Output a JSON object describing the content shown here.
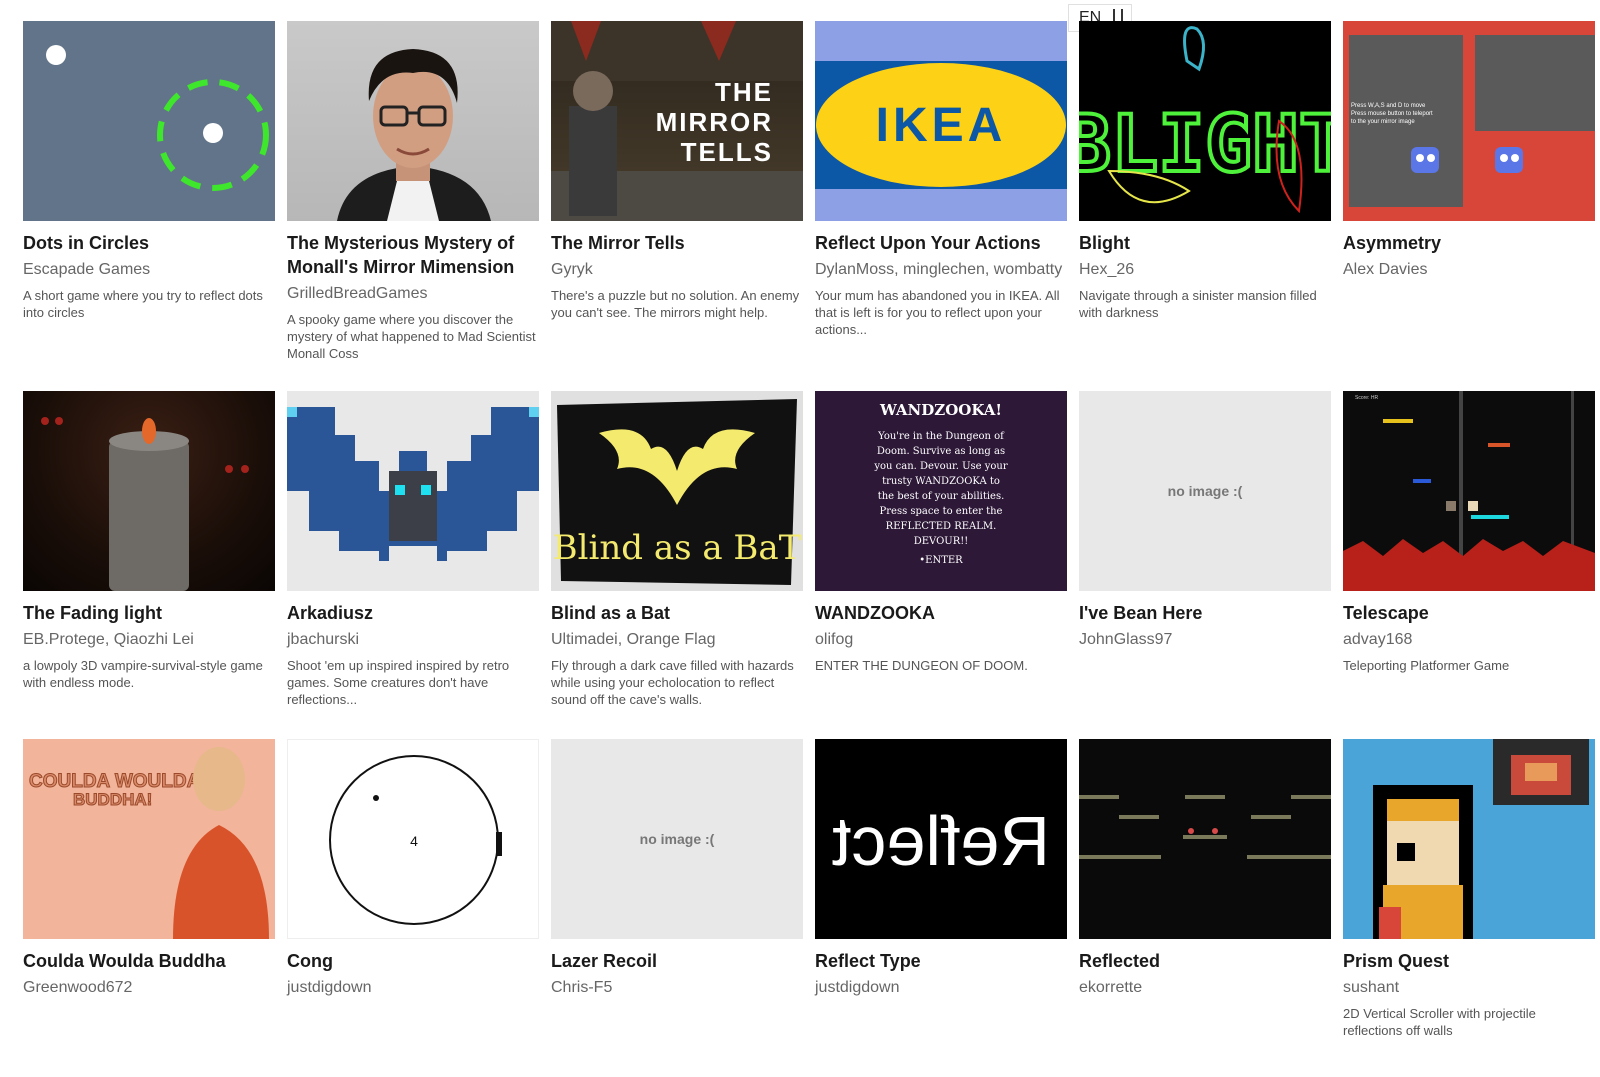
{
  "language_selector": {
    "label": "EN"
  },
  "games": [
    {
      "title": "Dots in Circles",
      "authors": [
        "Escapade Games"
      ],
      "description": "A short game where you try to reflect dots into circles",
      "image": "thumb-dots"
    },
    {
      "title": "The Mysterious Mystery of Monall's Mirror Mimension",
      "authors": [
        "GrilledBreadGames"
      ],
      "description": "A spooky game where you discover the mystery of what happened to Mad Scientist Monall Coss",
      "image": "thumb-portrait"
    },
    {
      "title": "The Mirror Tells",
      "authors": [
        "Gyryk"
      ],
      "description": "There's a puzzle but no solution. An enemy you can't see. The mirrors might help.",
      "image": "thumb-mirror-tells",
      "thumb_text": "THE\nMIRROR\nTELLS"
    },
    {
      "title": "Reflect Upon Your Actions",
      "authors": [
        "DylanMoss",
        "minglechen",
        "wombatty"
      ],
      "description": "Your mum has abandoned you in IKEA. All that is left is for you to reflect upon your actions...",
      "image": "thumb-ikea",
      "thumb_text": "IKEA"
    },
    {
      "title": "Blight",
      "authors": [
        "Hex_26"
      ],
      "description": "Navigate through a sinister mansion filled with darkness",
      "image": "thumb-blight",
      "thumb_text": "BLIGHT"
    },
    {
      "title": "Asymmetry",
      "authors": [
        "Alex Davies"
      ],
      "description": "",
      "image": "thumb-asymmetry",
      "thumb_text": "Press W,A,S and D to move\nPress mouse button to teleport\nto the your mirror image"
    },
    {
      "title": "The Fading light",
      "authors": [
        "EB.Protege",
        "Qiaozhi Lei"
      ],
      "description": "a lowpoly 3D vampire-survival-style game with endless mode.",
      "image": "thumb-candle"
    },
    {
      "title": "Arkadiusz",
      "authors": [
        "jbachurski"
      ],
      "description": "Shoot 'em up inspired inspired by retro games. Some creatures don't have reflections...",
      "image": "thumb-pixel-bat"
    },
    {
      "title": "Blind as a Bat",
      "authors": [
        "Ultimadei",
        "Orange Flag"
      ],
      "description": "Fly through a dark cave filled with hazards while using your echolocation to reflect sound off the cave's walls.",
      "image": "thumb-blind-bat",
      "thumb_text": "Blind as a BaT"
    },
    {
      "title": "WANDZOOKA",
      "authors": [
        "olifog"
      ],
      "description": "ENTER THE DUNGEON OF DOOM.",
      "image": "thumb-wandzooka",
      "thumb_text": "WANDZOOKA!\nYou're in the Dungeon of\nDoom. Survive as long as\nyou can. Devour. Use your\ntrusty WANDZOOKA to\nthe best of your abilities.\nPress space to enter the\nREFLECTED REALM.\nDEVOUR!!\n•ENTER"
    },
    {
      "title": "I've Bean Here",
      "authors": [
        "JohnGlass97"
      ],
      "description": "",
      "image": "none",
      "thumb_text": "no image :("
    },
    {
      "title": "Telescape",
      "authors": [
        "advay168"
      ],
      "description": "Teleporting Platformer Game",
      "image": "thumb-telescape",
      "thumb_text": "Score: HR"
    },
    {
      "title": "Coulda Woulda Buddha",
      "authors": [
        "Greenwood672"
      ],
      "description": "",
      "image": "thumb-buddha",
      "thumb_text": "COULDA WOULDA\nBUDDHA!"
    },
    {
      "title": "Cong",
      "authors": [
        "justdigdown"
      ],
      "description": "",
      "image": "thumb-cong",
      "thumb_text": "4"
    },
    {
      "title": "Lazer Recoil",
      "authors": [
        "Chris-F5"
      ],
      "description": "",
      "image": "none",
      "thumb_text": "no image :("
    },
    {
      "title": "Reflect Type",
      "authors": [
        "justdigdown"
      ],
      "description": "",
      "image": "thumb-reflect-type",
      "thumb_text": "Reflect"
    },
    {
      "title": "Reflected",
      "authors": [
        "ekorrette"
      ],
      "description": "",
      "image": "thumb-reflected"
    },
    {
      "title": "Prism Quest",
      "authors": [
        "sushant"
      ],
      "description": "2D Vertical Scroller with projectile reflections off walls",
      "image": "thumb-prism-quest"
    }
  ]
}
